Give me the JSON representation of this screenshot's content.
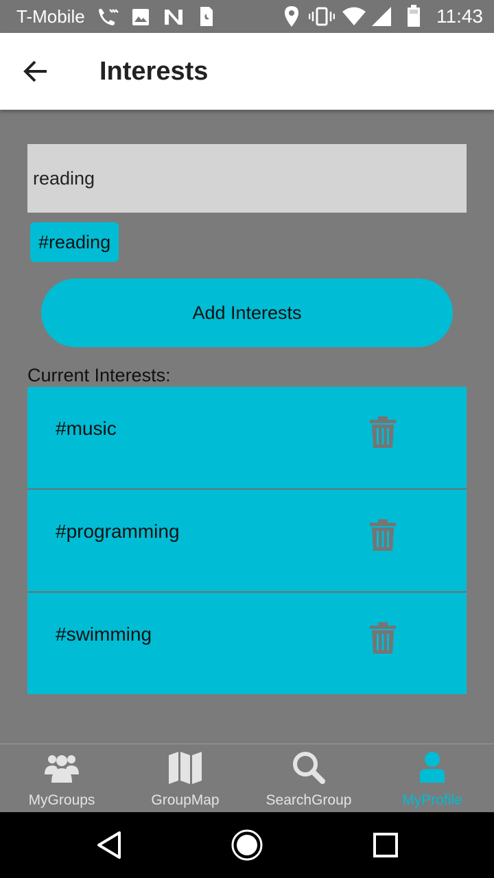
{
  "status_bar": {
    "carrier": "T-Mobile",
    "time": "11:43"
  },
  "app_bar": {
    "title": "Interests",
    "back_icon": "arrow-back-icon"
  },
  "form": {
    "input_value": "reading",
    "tag_preview": "#reading",
    "add_button_label": "Add Interests"
  },
  "current": {
    "label": "Current Interests:",
    "items": [
      {
        "label": "#music",
        "icon": "trash-icon"
      },
      {
        "label": "#programming",
        "icon": "trash-icon"
      },
      {
        "label": "#swimming",
        "icon": "trash-icon"
      }
    ]
  },
  "bottom_nav": {
    "items": [
      {
        "label": "MyGroups",
        "icon": "groups-icon"
      },
      {
        "label": "GroupMap",
        "icon": "map-icon"
      },
      {
        "label": "SearchGroup",
        "icon": "search-icon"
      },
      {
        "label": "MyProfile",
        "icon": "person-icon"
      }
    ],
    "active_index": 3
  },
  "colors": {
    "accent": "#00bcd4",
    "background": "#7b7b7b",
    "input_bg": "#d4d4d4",
    "app_bar": "#ffffff",
    "status_bar": "#757575"
  }
}
